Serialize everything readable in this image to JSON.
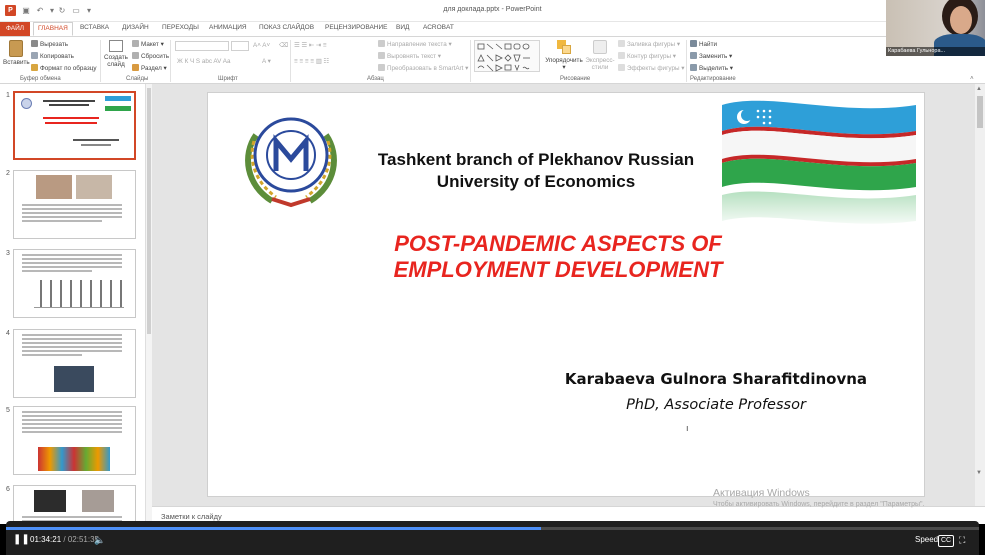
{
  "window": {
    "title": "для доклада.pptx - PowerPoint"
  },
  "tabs": [
    "ФАЙЛ",
    "ГЛАВНАЯ",
    "ВСТАВКА",
    "ДИЗАЙН",
    "ПЕРЕХОДЫ",
    "АНИМАЦИЯ",
    "ПОКАЗ СЛАЙДОВ",
    "РЕЦЕНЗИРОВАНИЕ",
    "ВИД",
    "АСROBAT"
  ],
  "ribbon": {
    "clipboard": {
      "paste": "Вставить",
      "cut": "Вырезать",
      "copy": "Копировать",
      "format_painter": "Формат по образцу",
      "group": "Буфер обмена"
    },
    "slides": {
      "new_slide": "Создать слайд",
      "layout": "Макет",
      "reset": "Сбросить",
      "section": "Раздел",
      "group": "Слайды"
    },
    "font": {
      "group": "Шрифт"
    },
    "paragraph": {
      "text_direction": "Направление текста",
      "align_text": "Выровнять текст",
      "smartart": "Преобразовать в SmartArt",
      "group": "Абзац"
    },
    "drawing": {
      "arrange": "Упорядочить",
      "quick_styles": "Экспресс-стили",
      "shape_fill": "Заливка фигуры",
      "shape_outline": "Контур фигуры",
      "shape_effects": "Эффекты фигуры",
      "group": "Рисование"
    },
    "editing": {
      "find": "Найти",
      "replace": "Заменить",
      "select": "Выделить",
      "group": "Редактирование"
    }
  },
  "slide_numbers": [
    "1",
    "2",
    "3",
    "4",
    "5",
    "6"
  ],
  "slide": {
    "header_line1": "Tashkent branch of Plekhanov Russian",
    "header_line2": "University of Economics",
    "title_line1": "POST-PANDEMIC ASPECTS OF",
    "title_line2": "EMPLOYMENT DEVELOPMENT",
    "author": "Karabaeva Gulnora Sharafitdinovna",
    "position": "PhD, Associate Professor"
  },
  "notes": {
    "placeholder": "Заметки к слайду"
  },
  "watermark": {
    "line1": "Активация Windows",
    "line2": "Чтобы активировать Windows, перейдите в раздел \"Параметры\"."
  },
  "player": {
    "current_time": "01:34:21",
    "separator": "/",
    "total_time": "02:51:35",
    "speed_label": "Speed",
    "progress": 0.55
  },
  "webcam": {
    "name": "Карабаева Гульнора..."
  },
  "colors": {
    "accent": "#d24726",
    "title_red": "#e8251f",
    "player_blue": "#4d8ff6"
  }
}
